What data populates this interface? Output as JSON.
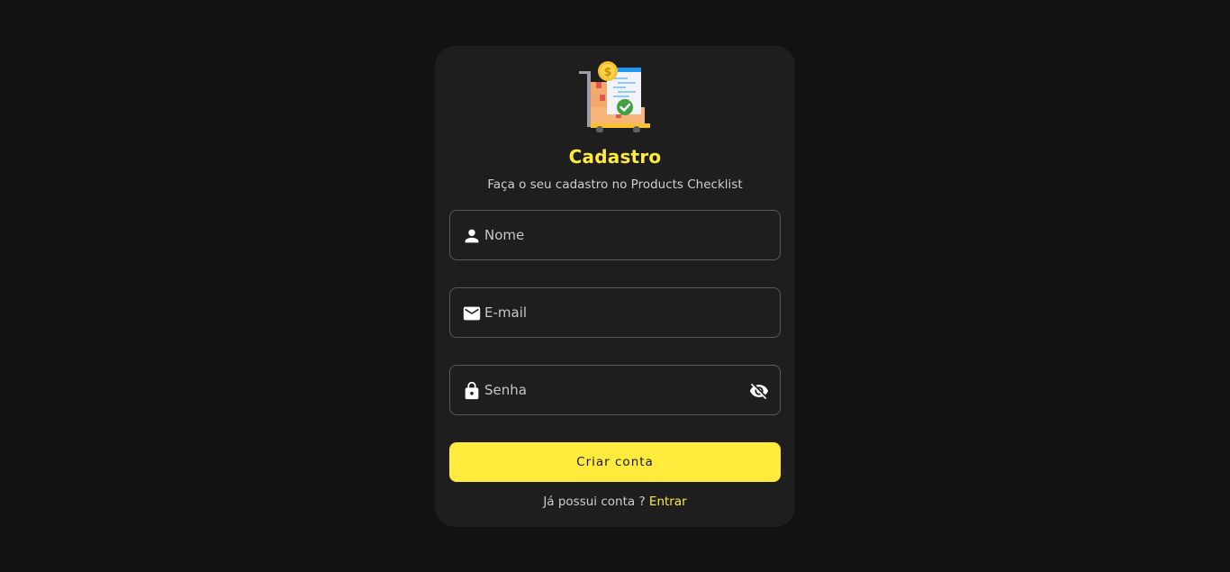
{
  "logo": {
    "icon": "cart-checklist-icon"
  },
  "header": {
    "title": "Cadastro",
    "subtitle": "Faça o seu cadastro no Products Checklist"
  },
  "form": {
    "name": {
      "placeholder": "Nome",
      "value": "",
      "icon": "person-icon"
    },
    "email": {
      "placeholder": "E-mail",
      "value": "",
      "icon": "mail-icon"
    },
    "password": {
      "placeholder": "Senha",
      "value": "",
      "icon": "lock-icon",
      "visibility_icon": "eye-off-icon"
    },
    "submit_label": "Criar conta"
  },
  "footer": {
    "prompt": "Já possui conta ?",
    "link_label": "Entrar"
  },
  "colors": {
    "background": "#121212",
    "card": "#1e1e1e",
    "accent": "#ffeb3b",
    "border": "#5a5a5a"
  }
}
